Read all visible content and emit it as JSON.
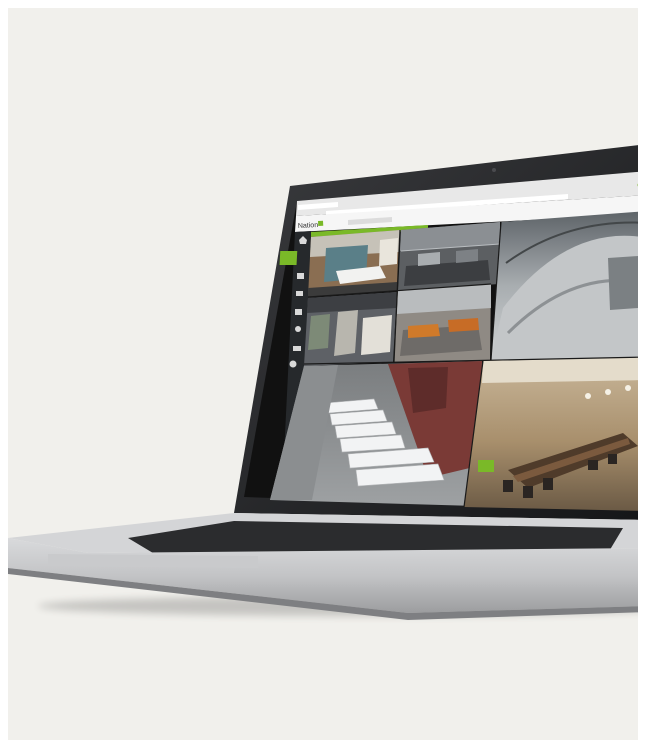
{
  "app": {
    "logo_text": "Nation",
    "brand_color": "#7ab928"
  },
  "browser": {
    "tab_title": "",
    "address": ""
  },
  "toolbar": {
    "label": ""
  },
  "sidebar_icons": [
    "home-icon",
    "grid-icon",
    "camera-icon",
    "map-icon",
    "user-icon",
    "list-icon",
    "settings-icon"
  ],
  "cameras": [
    {
      "name": "meeting-room",
      "label": ""
    },
    {
      "name": "parking-garage",
      "label": ""
    },
    {
      "name": "fisheye-warehouse",
      "label": ""
    },
    {
      "name": "hallway",
      "label": ""
    },
    {
      "name": "lounge",
      "label": ""
    },
    {
      "name": "loading-dock",
      "label": ""
    },
    {
      "name": "boardroom",
      "label": ""
    }
  ],
  "colors": {
    "backdrop": "#f1f0ec",
    "bezel": "#1b1c1e",
    "chassis": "#c9cacc",
    "keyboard": "#2b2c2e",
    "accent": "#7ab928"
  }
}
